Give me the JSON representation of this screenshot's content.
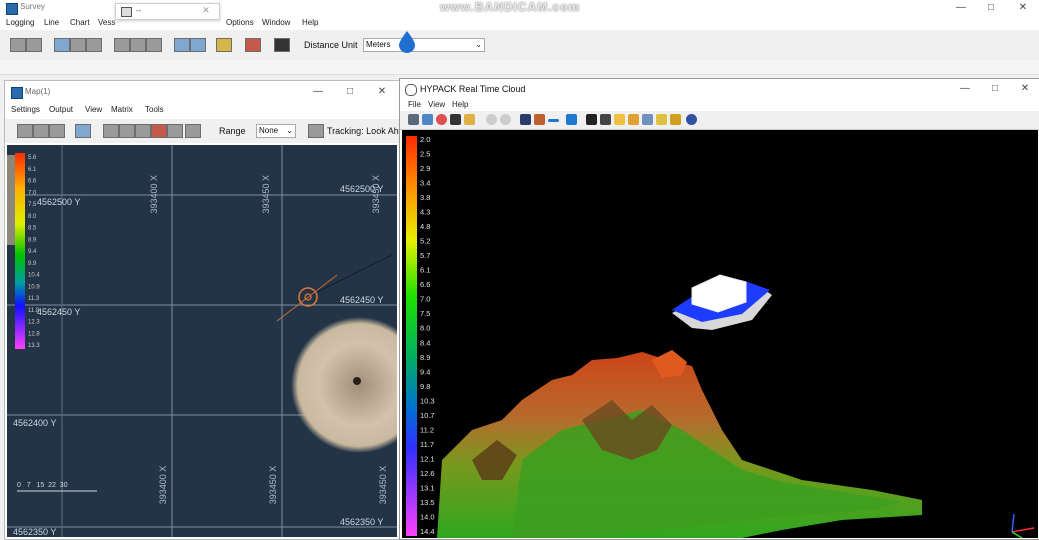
{
  "survey": {
    "title": "Survey",
    "menu": [
      "Logging",
      "Line",
      "Chart",
      "Vess",
      "Options",
      "Window",
      "Help"
    ],
    "distance_unit_label": "Distance Unit",
    "distance_unit_value": "Meters"
  },
  "watermark": "www.BANDICAM.com",
  "popup": {
    "title": "--"
  },
  "map_window": {
    "title": "Map(1)",
    "menu": [
      "Settings",
      "Output",
      "View",
      "Matrix",
      "Tools"
    ],
    "range_label": "Range",
    "range_value": "None",
    "tracking_label": "Tracking: Look Ah",
    "legend_values": [
      "5.6",
      "6.1",
      "6.6",
      "7.0",
      "7.5",
      "8.0",
      "8.5",
      "8.9",
      "9.4",
      "9.9",
      "10.4",
      "10.9",
      "11.3",
      "11.8",
      "12.3",
      "12.8",
      "13.3"
    ],
    "grid_x_labels": [
      "393400 X",
      "393450 X"
    ],
    "grid_y_labels": [
      "4562450 Y",
      "4562400 Y",
      "4562350 Y"
    ],
    "grid_y_right_labels": [
      "4562500 Y",
      "4562450 Y",
      "4562350 Y"
    ],
    "grid_x_bottom_labels": [
      "393400 X",
      "393450 X"
    ],
    "left_y_top_label": "4562500 Y",
    "left_y_mid_label": "4562450 Y",
    "scale_label": "0   7   15  22  30"
  },
  "cloud_window": {
    "title": "HYPACK Real Time Cloud",
    "menu": [
      "File",
      "View",
      "Help"
    ],
    "legend_values": [
      "2.0",
      "2.5",
      "2.9",
      "3.4",
      "3.8",
      "4.3",
      "4.8",
      "5.2",
      "5.7",
      "6.1",
      "6.6",
      "7.0",
      "7.5",
      "8.0",
      "8.4",
      "8.9",
      "9.4",
      "9.8",
      "10.3",
      "10.7",
      "11.2",
      "11.7",
      "12.1",
      "12.6",
      "13.1",
      "13.5",
      "14.0",
      "14.4"
    ]
  },
  "colors": {
    "map_bg": "#243447",
    "cloud_bg": "#000000",
    "boat_hull": "#1e3cff",
    "boat_cabin": "#ffffff"
  }
}
